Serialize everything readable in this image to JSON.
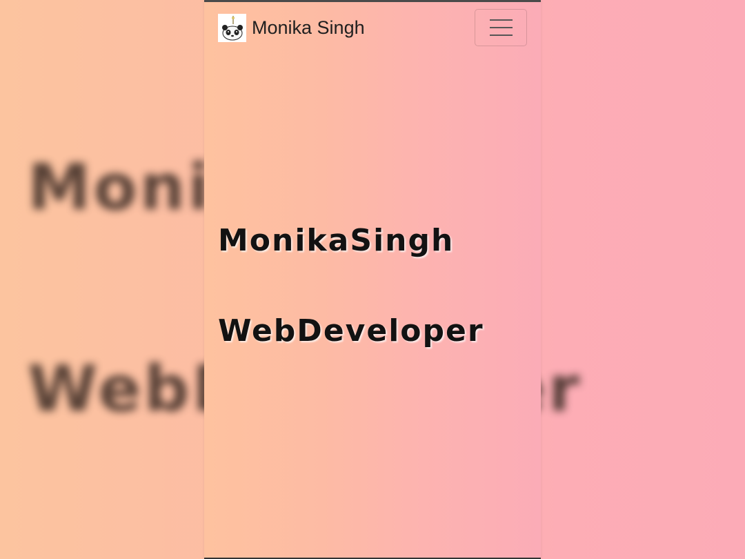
{
  "navbar": {
    "brand_name": "Monika Singh",
    "logo_icon": "panda-icon",
    "menu_icon": "hamburger-menu-icon"
  },
  "hero": {
    "title": "MonikaSingh",
    "subtitle": "WebDeveloper"
  },
  "colors": {
    "gradient_start": "#fec29f",
    "gradient_end": "#fbacb7",
    "text": "#121212"
  }
}
